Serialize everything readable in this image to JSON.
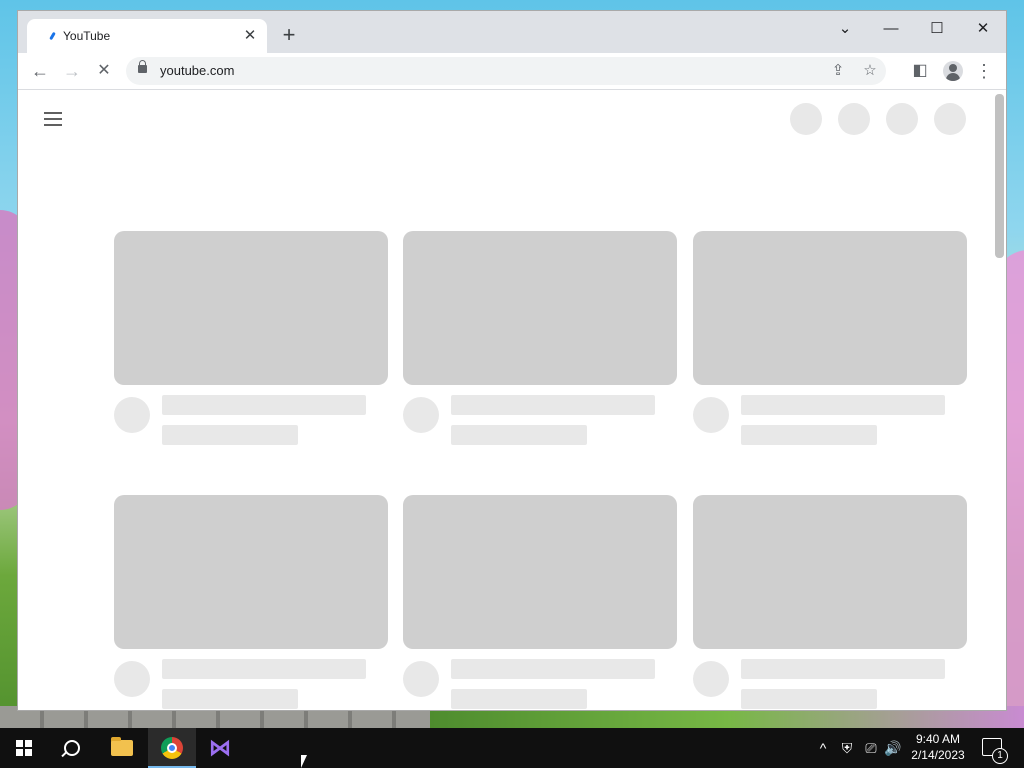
{
  "browser": {
    "tab": {
      "title": "YouTube",
      "close_label": "✕"
    },
    "new_tab_label": "+",
    "window_controls": {
      "dropdown": "⌄",
      "minimize": "—",
      "maximize": "☐",
      "close": "✕"
    },
    "toolbar": {
      "back": "←",
      "forward": "→",
      "stop": "✕",
      "url": "youtube.com",
      "share": "⇪",
      "bookmark": "☆",
      "side_panel": "◧",
      "menu": "⋮"
    }
  },
  "page": {
    "state": "loading-skeleton",
    "header_circles": 4,
    "card_rows": 2,
    "cards_per_row": 3,
    "colors": {
      "thumb": "#cfcfcf",
      "skeleton": "#e8e8e8"
    }
  },
  "taskbar": {
    "pinned": [
      "start-icon",
      "search-icon",
      "file-explorer-icon",
      "chrome-icon",
      "visual-studio-icon"
    ],
    "tray": {
      "chevron": "^",
      "volume": "🔊"
    },
    "clock": {
      "time": "9:40 AM",
      "date": "2/14/2023"
    },
    "notification_count": "1"
  }
}
